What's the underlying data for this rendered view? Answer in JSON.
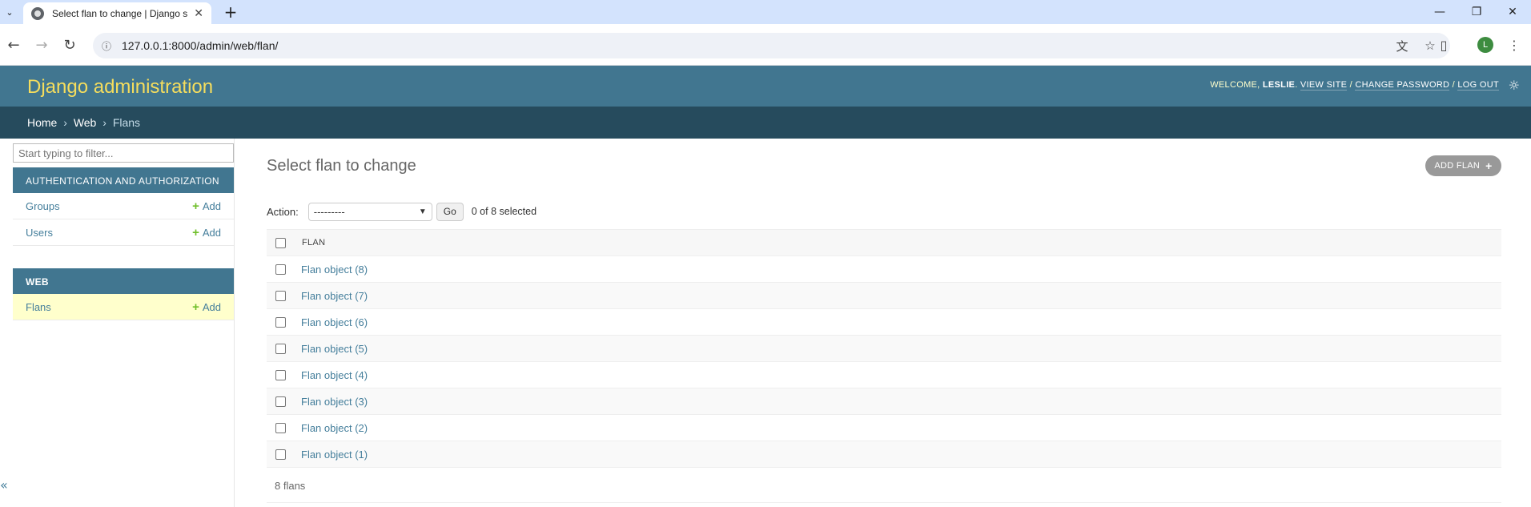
{
  "browser": {
    "tab_title": "Select flan to change | Django s",
    "url": "127.0.0.1:8000/admin/web/flan/",
    "profile_initial": "L"
  },
  "header": {
    "brand": "Django administration",
    "welcome": "WELCOME,",
    "username": "LESLIE",
    "view_site": "VIEW SITE",
    "change_password": "CHANGE PASSWORD",
    "log_out": "LOG OUT",
    "sep": "/"
  },
  "breadcrumbs": {
    "home": "Home",
    "app": "Web",
    "current": "Flans",
    "sep": "›"
  },
  "sidebar": {
    "filter_placeholder": "Start typing to filter...",
    "add_label": "Add",
    "modules": [
      {
        "caption": "AUTHENTICATION AND AUTHORIZATION",
        "models": [
          "Groups",
          "Users"
        ]
      },
      {
        "caption": "WEB",
        "models": [
          "Flans"
        ]
      }
    ],
    "collapse_icon": "«"
  },
  "main": {
    "title": "Select flan to change",
    "add_button": "ADD FLAN",
    "action_label": "Action:",
    "action_selected": "---------",
    "go_label": "Go",
    "selected_count": "0 of 8 selected",
    "column_header": "FLAN",
    "rows": [
      "Flan object (8)",
      "Flan object (7)",
      "Flan object (6)",
      "Flan object (5)",
      "Flan object (4)",
      "Flan object (3)",
      "Flan object (2)",
      "Flan object (1)"
    ],
    "paginator": "8 flans"
  },
  "colors": {
    "header_bg": "#417690",
    "breadcrumbs_bg": "#264b5d",
    "brand": "#f5dd5d",
    "link": "#447e9b",
    "add_plus": "#70bf2b",
    "current_row": "#ffffcc"
  }
}
